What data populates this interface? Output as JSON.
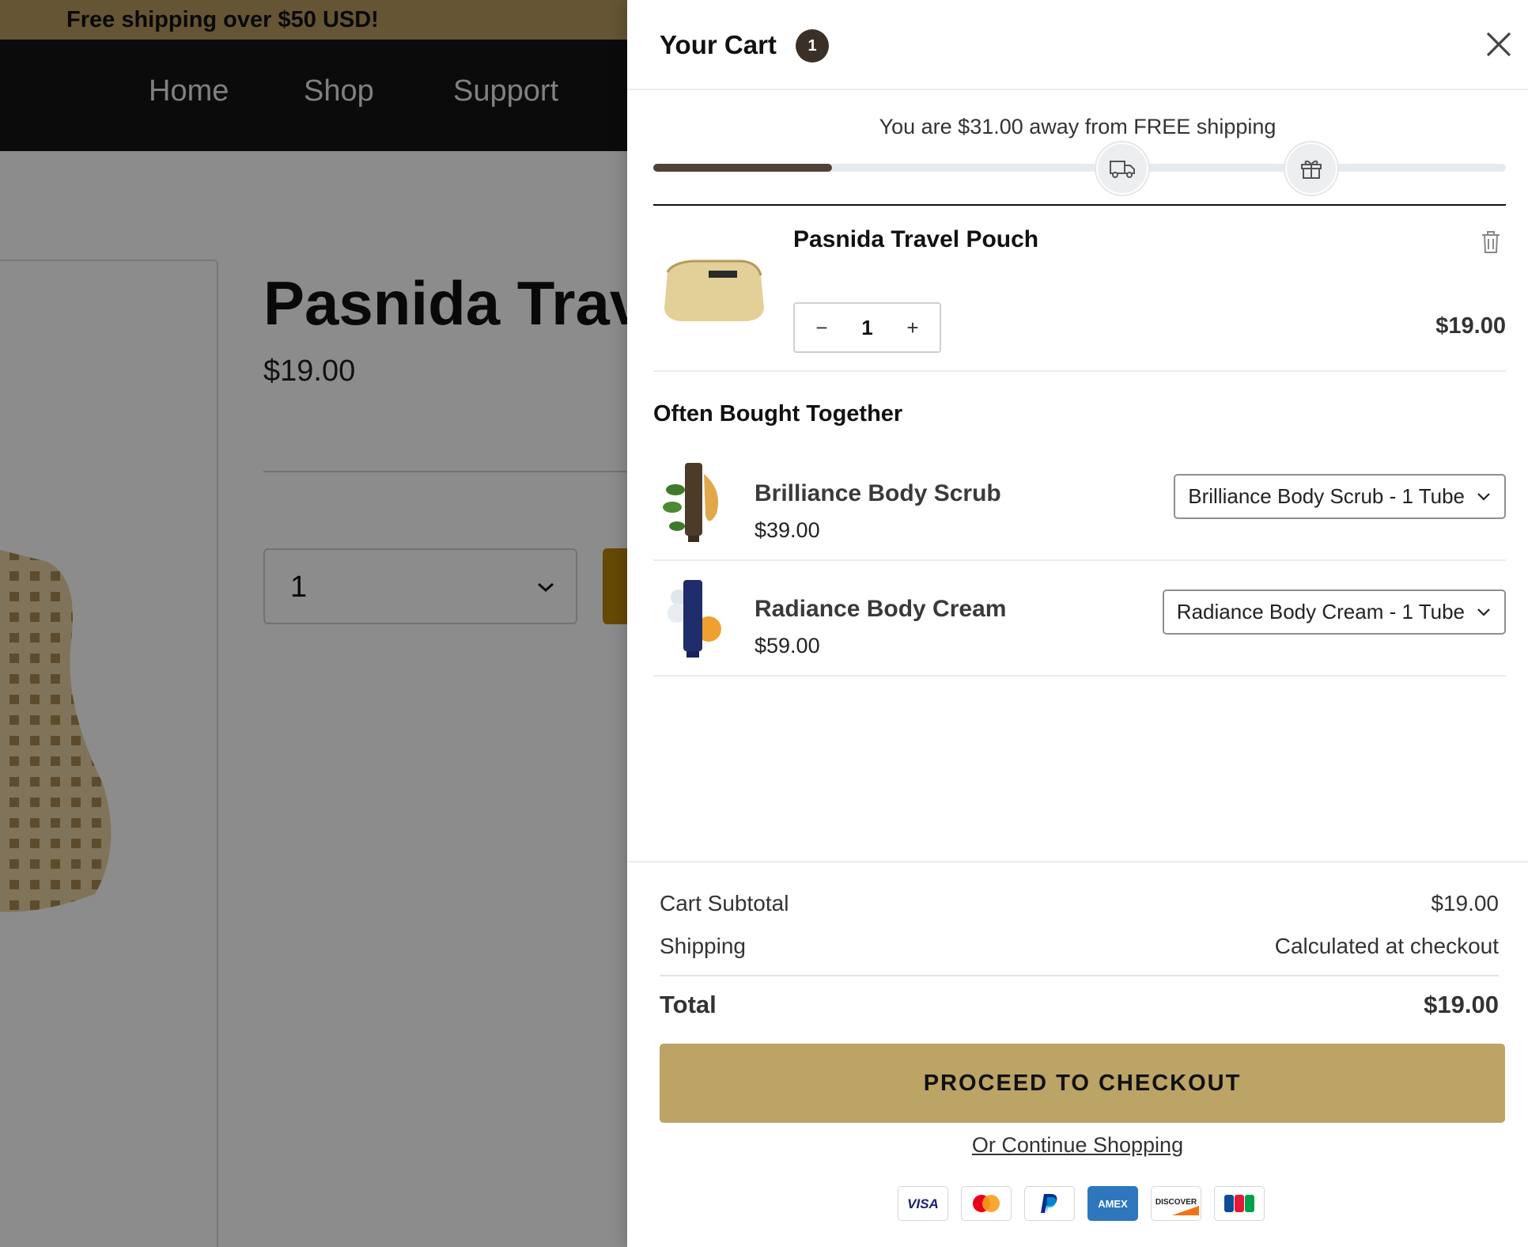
{
  "announcement": {
    "text": "Free shipping over $50 USD!"
  },
  "nav": {
    "home": "Home",
    "shop": "Shop",
    "support": "Support"
  },
  "product": {
    "title": "Pasnida Trav",
    "price": "$19.00",
    "quantity": "1"
  },
  "cart": {
    "title": "Your Cart",
    "count": "1",
    "shipping_message": "You are $31.00 away from FREE shipping",
    "shipping_progress": 0.21,
    "line_item": {
      "name": "Pasnida Travel Pouch",
      "quantity": "1",
      "minus": "−",
      "plus": "+",
      "price": "$19.00"
    },
    "often_bought_title": "Often Bought Together",
    "recommendations": [
      {
        "name": "Brilliance Body Scrub",
        "price": "$39.00",
        "variant": "Brilliance Body Scrub - 1 Tube"
      },
      {
        "name": "Radiance Body Cream",
        "price": "$59.00",
        "variant": "Radiance Body Cream - 1 Tube"
      }
    ],
    "summary": {
      "subtotal_label": "Cart Subtotal",
      "subtotal_value": "$19.00",
      "shipping_label": "Shipping",
      "shipping_value": "Calculated at checkout",
      "total_label": "Total",
      "total_value": "$19.00"
    },
    "checkout_label": "PROCEED TO CHECKOUT",
    "continue_label": "Or Continue Shopping",
    "payment_icons": [
      "visa-icon",
      "mastercard-icon",
      "paypal-icon",
      "amex-icon",
      "discover-icon",
      "jcb-icon"
    ]
  },
  "colors": {
    "announcement_bg": "#b99b5f",
    "nav_bg": "#141414",
    "cart_badge": "#3b3027",
    "progress_fill": "#4f4236",
    "checkout_button": "#bca366"
  }
}
